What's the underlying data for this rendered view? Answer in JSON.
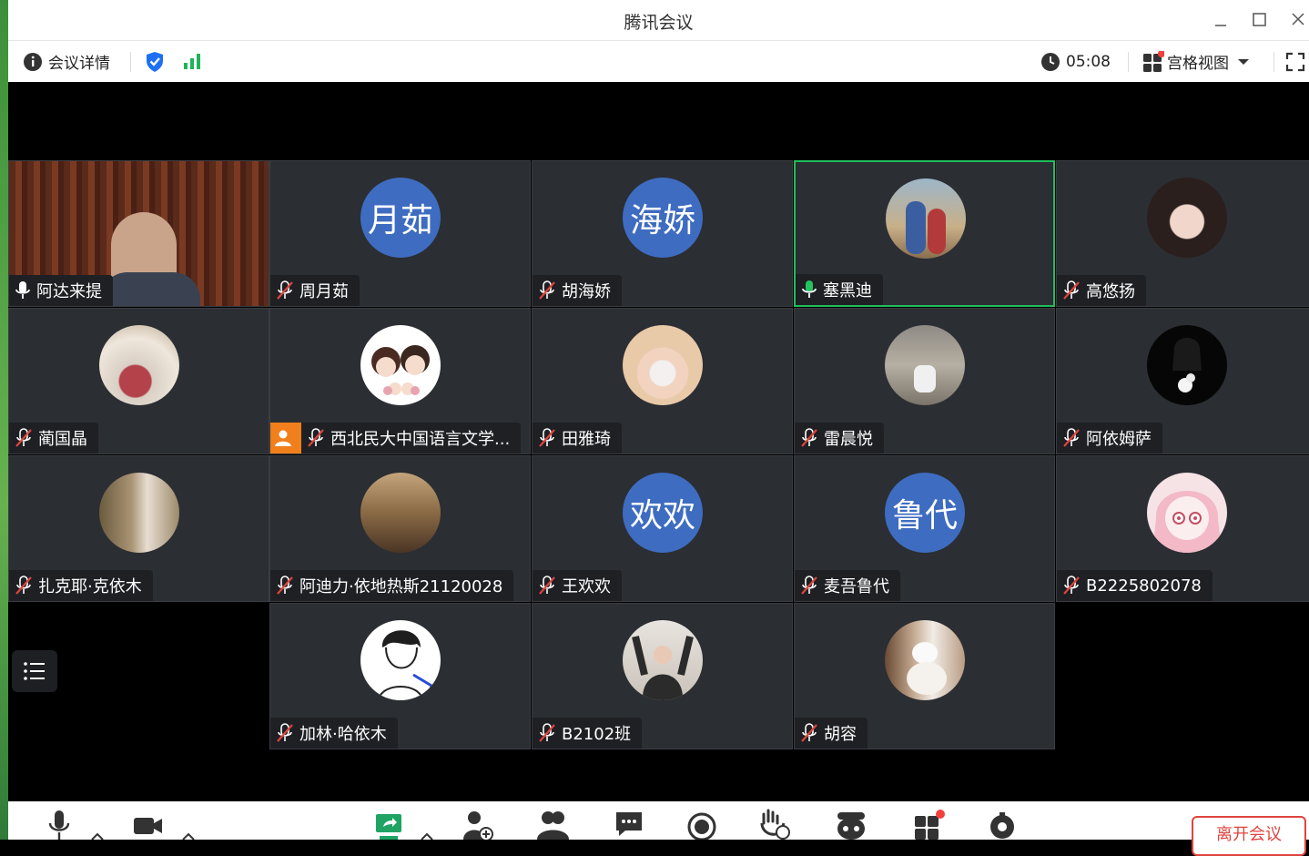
{
  "window": {
    "title": "腾讯会议"
  },
  "toolbar": {
    "meeting_details": "会议详情",
    "timer": "05:08",
    "view_mode": "宫格视图"
  },
  "participants": [
    {
      "name": "阿达来提",
      "avatar_text": "",
      "mic": "on",
      "photo": "video"
    },
    {
      "name": "周月茹",
      "avatar_text": "月茹",
      "mic": "muted"
    },
    {
      "name": "胡海娇",
      "avatar_text": "海娇",
      "mic": "muted"
    },
    {
      "name": "塞黑迪",
      "avatar_text": "",
      "mic": "speaking",
      "active": true
    },
    {
      "name": "高悠扬",
      "avatar_text": "",
      "mic": "muted"
    },
    {
      "name": "蔺国晶",
      "avatar_text": "",
      "mic": "muted"
    },
    {
      "name": "西北民大中国语言文学...",
      "avatar_text": "",
      "mic": "muted",
      "host": true
    },
    {
      "name": "田雅琦",
      "avatar_text": "",
      "mic": "muted"
    },
    {
      "name": "雷晨悦",
      "avatar_text": "",
      "mic": "muted"
    },
    {
      "name": "阿依姆萨",
      "avatar_text": "",
      "mic": "muted"
    },
    {
      "name": "扎克耶·克依木",
      "avatar_text": "",
      "mic": "muted"
    },
    {
      "name": "阿迪力·依地热斯21120028",
      "avatar_text": "",
      "mic": "muted"
    },
    {
      "name": "王欢欢",
      "avatar_text": "欢欢",
      "mic": "muted"
    },
    {
      "name": "麦吾鲁代",
      "avatar_text": "鲁代",
      "mic": "muted"
    },
    {
      "name": "B2225802078",
      "avatar_text": "",
      "mic": "muted"
    },
    {
      "name": "加林·哈依木",
      "avatar_text": "",
      "mic": "muted"
    },
    {
      "name": "B2102班",
      "avatar_text": "",
      "mic": "muted"
    },
    {
      "name": "胡容",
      "avatar_text": "",
      "mic": "muted"
    }
  ],
  "bottombar": {
    "leave_label": "离开会议"
  },
  "colors": {
    "accent": "#3e6cc0",
    "active_border": "#1fbe5b",
    "danger": "#e0443e",
    "tile_bg": "#2b2e33"
  }
}
